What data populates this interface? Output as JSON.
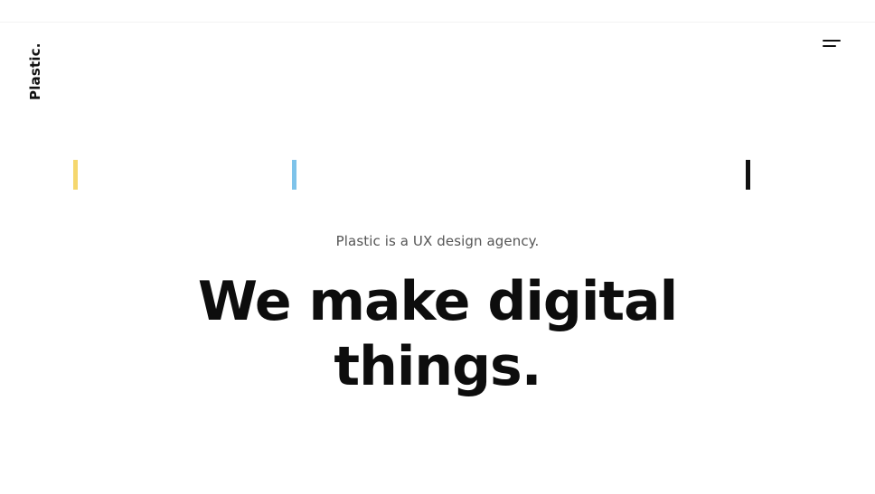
{
  "brand": {
    "logo_text": "Plastic."
  },
  "nav": {
    "menu_icon": "hamburger-menu-icon"
  },
  "accents": {
    "yellow": "#f5d76e",
    "blue": "#7ec3ea",
    "black": "#111111"
  },
  "hero": {
    "tagline": "Plastic is a UX design agency.",
    "headline_line1": "We make digital",
    "headline_line2": "things."
  }
}
